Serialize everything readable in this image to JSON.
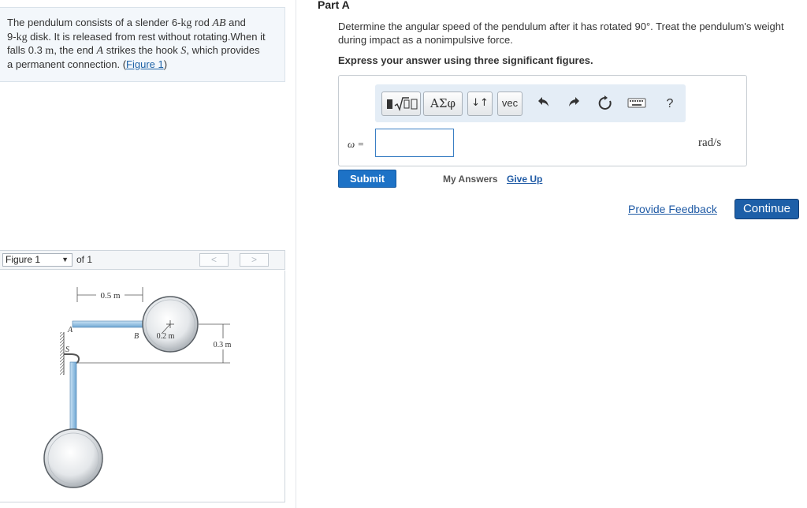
{
  "problem": {
    "t1": "The pendulum consists of a slender 6-",
    "kg1": "kg",
    "t2": " rod ",
    "rod_name": "AB",
    "t3": " and",
    "t4": "9-",
    "kg2": "kg",
    "t5": " disk. It is released from rest without rotating.When it",
    "t6": "falls 0.3 ",
    "m_unit": "m",
    "t7": ", the end ",
    "end_a": "A",
    "t8": " strikes the hook ",
    "hook_s": "S",
    "t9": ", which provides",
    "t10": "a permanent connection. (",
    "figure_link": "Figure 1",
    "t11": ")"
  },
  "figure_nav": {
    "selected": "Figure 1",
    "of_text": "of 1",
    "prev": "<",
    "next": ">"
  },
  "figure": {
    "label_rod_length": "0.5 m",
    "label_radius": "0.2 m",
    "label_drop": "0.3 m",
    "label_a": "A",
    "label_b": "B",
    "label_s": "S"
  },
  "part": {
    "title": "Part A",
    "question": "Determine the angular speed of the pendulum after it has rotated 90°. Treat the pendulum's weight during impact as a nonimpulsive force.",
    "instruction": "Express your answer using three significant figures."
  },
  "toolbar": {
    "templates_icon": "template-sqrt-icon",
    "greek_label": "ΑΣφ",
    "arrows_label": "↓↑",
    "vec_label": "vec",
    "undo_icon": "undo-icon",
    "redo_icon": "redo-icon",
    "reset_icon": "reset-icon",
    "keyboard_icon": "keyboard-icon",
    "help_label": "?"
  },
  "answer": {
    "variable": "ω =",
    "value": "",
    "unit": "rad/s"
  },
  "actions": {
    "submit": "Submit",
    "my_answers": "My Answers",
    "give_up": "Give Up",
    "feedback": "Provide Feedback",
    "continue": "Continue"
  },
  "colors": {
    "accent_blue": "#1d72c6",
    "continue_blue": "#1d5fa8",
    "link_blue": "#1f5aa5",
    "rod_blue": "#8fc0e6",
    "toolbar_bg": "#e4edf6"
  }
}
